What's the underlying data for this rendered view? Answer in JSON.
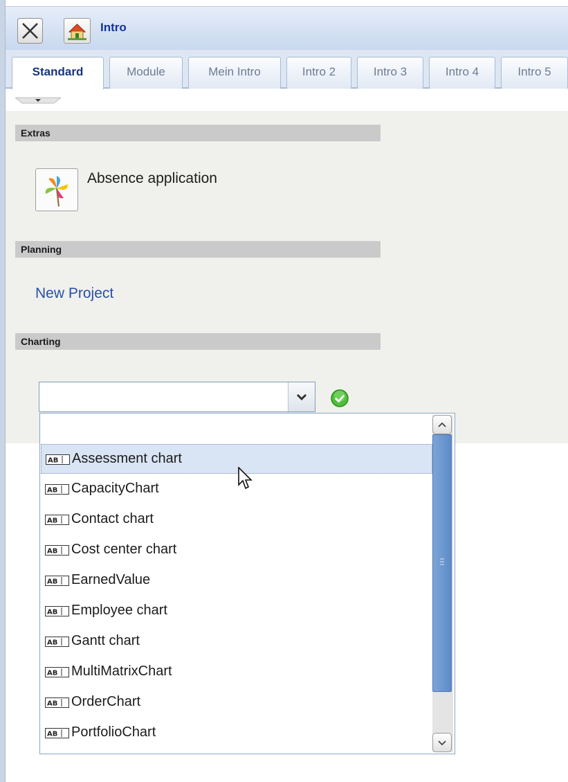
{
  "window": {
    "title": "Intro",
    "close_icon": "close-x-icon",
    "home_icon": "home-icon"
  },
  "tabs": [
    {
      "label": "Standard",
      "active": true
    },
    {
      "label": "Module"
    },
    {
      "label": "Mein Intro"
    },
    {
      "label": "Intro 2"
    },
    {
      "label": "Intro 3"
    },
    {
      "label": "Intro 4"
    },
    {
      "label": "Intro 5"
    }
  ],
  "sections": {
    "extras": {
      "title": "Extras",
      "app_label": "Absence application",
      "app_icon": "pinwheel-icon"
    },
    "planning": {
      "title": "Planning",
      "link": "New Project"
    },
    "charting": {
      "title": "Charting",
      "combo_value": "",
      "ok_icon": "green-check-icon"
    }
  },
  "dropdown": {
    "item_icon": "text-field-ab-icon",
    "items": [
      "Assessment chart",
      "CapacityChart",
      "Contact chart",
      "Cost center chart",
      "EarnedValue",
      "Employee chart",
      "Gantt chart",
      "MultiMatrixChart",
      "OrderChart",
      "PortfolioChart"
    ],
    "selected_index": 0
  },
  "colors": {
    "title_text": "#14339a",
    "link": "#2a4fa8",
    "selected_row": "#d9e4f4",
    "scroll_thumb": "#6b97d0"
  }
}
